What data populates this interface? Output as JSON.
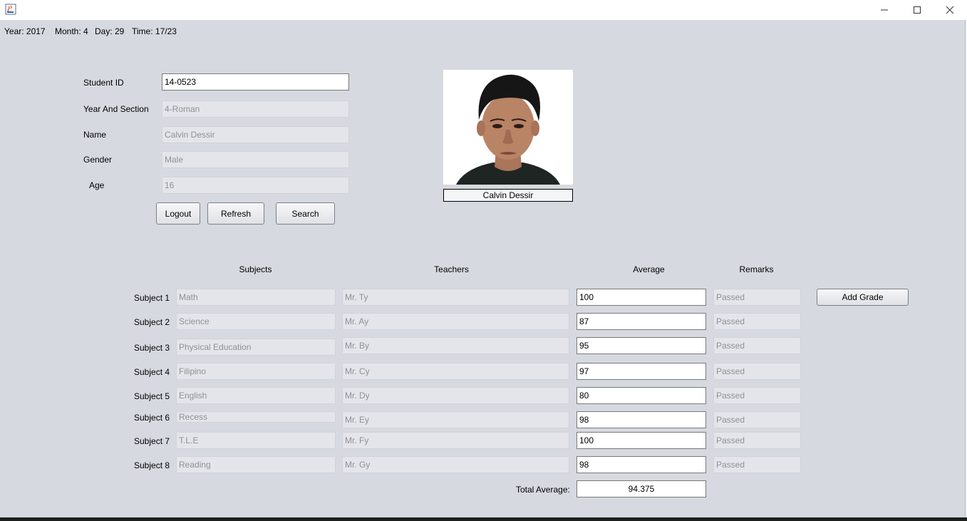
{
  "window": {
    "minimize_icon": "minimize-icon",
    "maximize_icon": "maximize-icon",
    "close_icon": "close-icon"
  },
  "status": {
    "year_label": "Year: 2017",
    "month_label": "Month: 4",
    "day_label": "Day: 29",
    "time_label": "Time: 17/23"
  },
  "student": {
    "id_label": "Student ID",
    "id_value": "14-0523",
    "section_label": "Year And Section",
    "section_value": "4-Roman",
    "name_label": "Name",
    "name_value": "Calvin Dessir",
    "gender_label": "Gender",
    "gender_value": "Male",
    "age_label": "Age",
    "age_value": "16"
  },
  "buttons": {
    "logout": "Logout",
    "refresh": "Refresh",
    "search": "Search",
    "add_grade": "Add Grade"
  },
  "photo": {
    "caption": "Calvin Dessir"
  },
  "grades": {
    "headers": {
      "subjects": "Subjects",
      "teachers": "Teachers",
      "average": "Average",
      "remarks": "Remarks"
    },
    "rows": [
      {
        "label": "Subject 1",
        "subject": "Math",
        "teacher": "Mr. Ty",
        "average": "100",
        "remarks": "Passed"
      },
      {
        "label": "Subject 2",
        "subject": "Science",
        "teacher": "Mr. Ay",
        "average": "87",
        "remarks": "Passed"
      },
      {
        "label": "Subject 3",
        "subject": "Physical Education",
        "teacher": "Mr. By",
        "average": "95",
        "remarks": "Passed"
      },
      {
        "label": "Subject 4",
        "subject": "Filipino",
        "teacher": "Mr. Cy",
        "average": "97",
        "remarks": "Passed"
      },
      {
        "label": "Subject 5",
        "subject": "English",
        "teacher": "Mr. Dy",
        "average": "80",
        "remarks": "Passed"
      },
      {
        "label": "Subject 6",
        "subject": "Recess",
        "teacher": "Mr. Ey",
        "average": "98",
        "remarks": "Passed"
      },
      {
        "label": "Subject 7",
        "subject": "T.L.E",
        "teacher": "Mr. Fy",
        "average": "100",
        "remarks": "Passed"
      },
      {
        "label": "Subject 8",
        "subject": "Reading",
        "teacher": "Mr. Gy",
        "average": "98",
        "remarks": "Passed"
      }
    ],
    "total_label": "Total Average:",
    "total_value": "94.375"
  }
}
